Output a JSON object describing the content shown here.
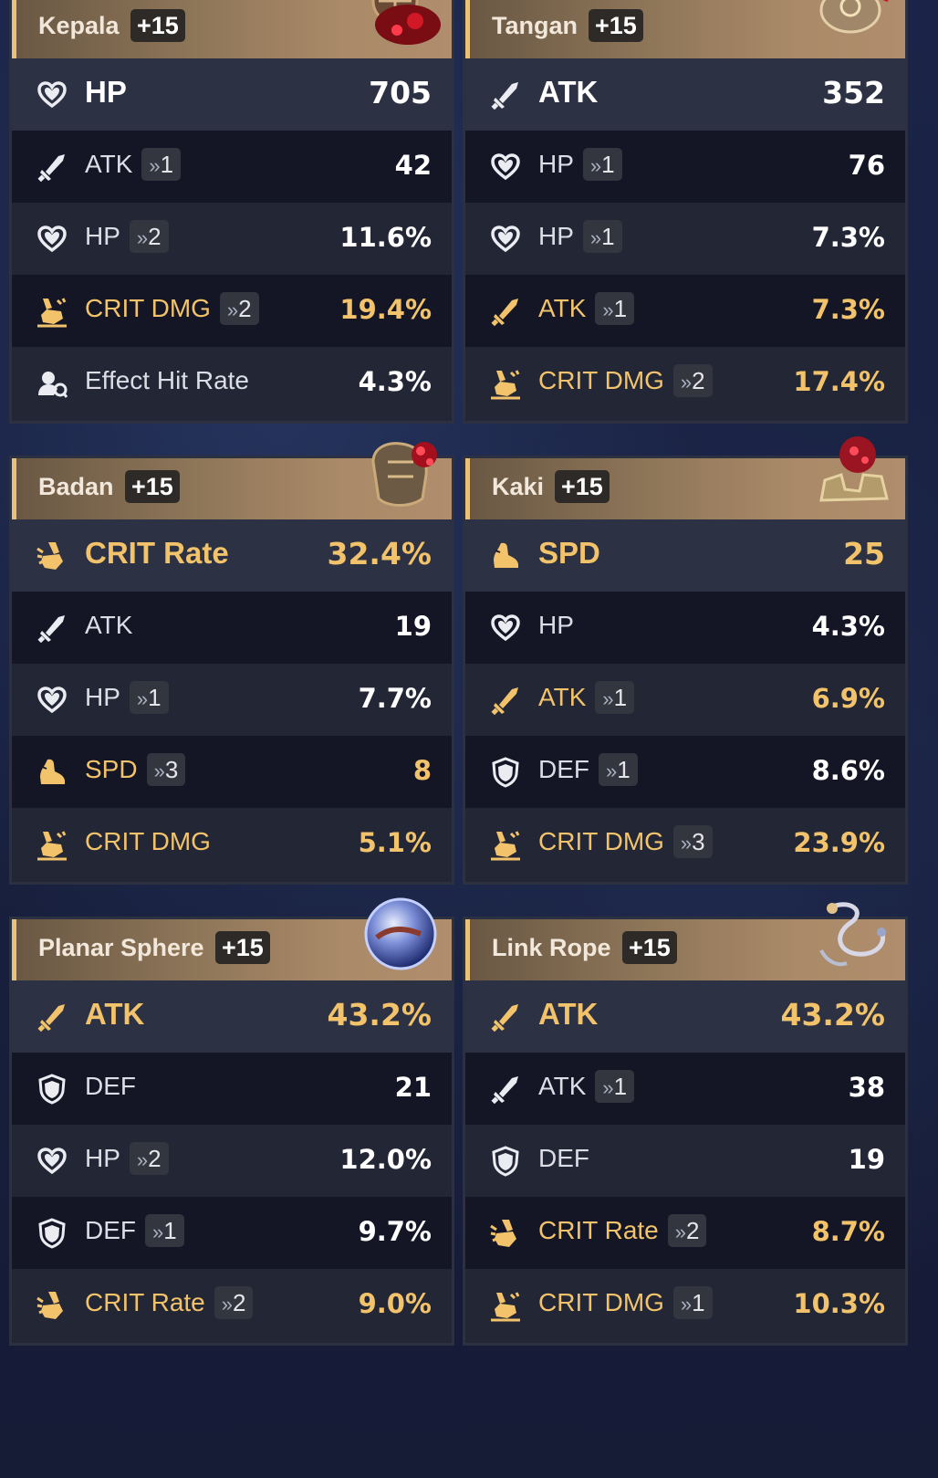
{
  "relics": [
    {
      "slot": "Kepala",
      "level": "+15",
      "art": "helmet-icon",
      "main": {
        "icon": "heart-icon",
        "stat": "HP",
        "value": "705",
        "gold": false
      },
      "subs": [
        {
          "icon": "sword-icon",
          "stat": "ATK",
          "roll": "1",
          "value": "42",
          "gold": false
        },
        {
          "icon": "heart-icon",
          "stat": "HP",
          "roll": "2",
          "value": "11.6%",
          "gold": false
        },
        {
          "icon": "crit-dmg-icon",
          "stat": "CRIT DMG",
          "roll": "2",
          "value": "19.4%",
          "gold": true
        },
        {
          "icon": "effect-hit-icon",
          "stat": "Effect Hit Rate",
          "roll": "",
          "value": "4.3%",
          "gold": false
        }
      ]
    },
    {
      "slot": "Tangan",
      "level": "+15",
      "art": "gloves-icon",
      "main": {
        "icon": "sword-icon",
        "stat": "ATK",
        "value": "352",
        "gold": false
      },
      "subs": [
        {
          "icon": "heart-icon",
          "stat": "HP",
          "roll": "1",
          "value": "76",
          "gold": false
        },
        {
          "icon": "heart-icon",
          "stat": "HP",
          "roll": "1",
          "value": "7.3%",
          "gold": false
        },
        {
          "icon": "sword-icon",
          "stat": "ATK",
          "roll": "1",
          "value": "7.3%",
          "gold": true
        },
        {
          "icon": "crit-dmg-icon",
          "stat": "CRIT DMG",
          "roll": "2",
          "value": "17.4%",
          "gold": true
        }
      ]
    },
    {
      "slot": "Badan",
      "level": "+15",
      "art": "body-armor-icon",
      "main": {
        "icon": "crit-rate-icon",
        "stat": "CRIT Rate",
        "value": "32.4%",
        "gold": true
      },
      "subs": [
        {
          "icon": "sword-icon",
          "stat": "ATK",
          "roll": "",
          "value": "19",
          "gold": false
        },
        {
          "icon": "heart-icon",
          "stat": "HP",
          "roll": "1",
          "value": "7.7%",
          "gold": false
        },
        {
          "icon": "boot-icon",
          "stat": "SPD",
          "roll": "3",
          "value": "8",
          "gold": true
        },
        {
          "icon": "crit-dmg-icon",
          "stat": "CRIT DMG",
          "roll": "",
          "value": "5.1%",
          "gold": true
        }
      ]
    },
    {
      "slot": "Kaki",
      "level": "+15",
      "art": "boots-icon",
      "main": {
        "icon": "boot-icon",
        "stat": "SPD",
        "value": "25",
        "gold": true
      },
      "subs": [
        {
          "icon": "heart-icon",
          "stat": "HP",
          "roll": "",
          "value": "4.3%",
          "gold": false
        },
        {
          "icon": "sword-icon",
          "stat": "ATK",
          "roll": "1",
          "value": "6.9%",
          "gold": true
        },
        {
          "icon": "shield-icon",
          "stat": "DEF",
          "roll": "1",
          "value": "8.6%",
          "gold": false
        },
        {
          "icon": "crit-dmg-icon",
          "stat": "CRIT DMG",
          "roll": "3",
          "value": "23.9%",
          "gold": true
        }
      ]
    },
    {
      "slot": "Planar Sphere",
      "level": "+15",
      "art": "planar-sphere-icon",
      "main": {
        "icon": "sword-icon",
        "stat": "ATK",
        "value": "43.2%",
        "gold": true
      },
      "subs": [
        {
          "icon": "shield-icon",
          "stat": "DEF",
          "roll": "",
          "value": "21",
          "gold": false
        },
        {
          "icon": "heart-icon",
          "stat": "HP",
          "roll": "2",
          "value": "12.0%",
          "gold": false
        },
        {
          "icon": "shield-icon",
          "stat": "DEF",
          "roll": "1",
          "value": "9.7%",
          "gold": false
        },
        {
          "icon": "crit-rate-icon",
          "stat": "CRIT Rate",
          "roll": "2",
          "value": "9.0%",
          "gold": true
        }
      ]
    },
    {
      "slot": "Link Rope",
      "level": "+15",
      "art": "link-rope-icon",
      "main": {
        "icon": "sword-icon",
        "stat": "ATK",
        "value": "43.2%",
        "gold": true
      },
      "subs": [
        {
          "icon": "sword-icon",
          "stat": "ATK",
          "roll": "1",
          "value": "38",
          "gold": false
        },
        {
          "icon": "shield-icon",
          "stat": "DEF",
          "roll": "",
          "value": "19",
          "gold": false
        },
        {
          "icon": "crit-rate-icon",
          "stat": "CRIT Rate",
          "roll": "2",
          "value": "8.7%",
          "gold": true
        },
        {
          "icon": "crit-dmg-icon",
          "stat": "CRIT DMG",
          "roll": "1",
          "value": "10.3%",
          "gold": true
        }
      ]
    }
  ],
  "colors": {
    "gold": "#f2c36b",
    "white": "#ffffff",
    "header_accent": "#e8c27a"
  }
}
